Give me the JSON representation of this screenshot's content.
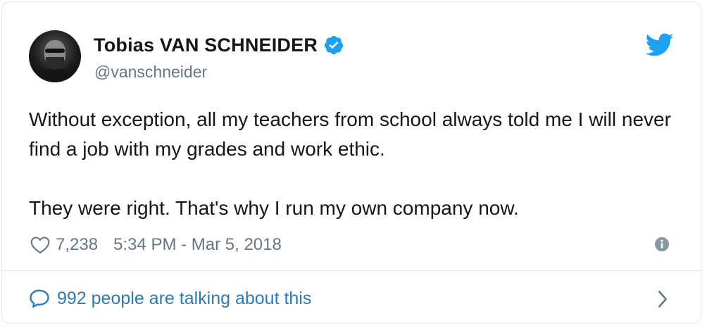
{
  "author": {
    "display_name": "Tobias VAN SCHNEIDER",
    "handle": "@vanschneider",
    "verified": true
  },
  "tweet": {
    "paragraphs": [
      "Without exception, all my teachers from school always told me I will never find a job with my grades and work ethic.",
      "They were right. That's why I run my own company now."
    ]
  },
  "meta": {
    "likes": "7,238",
    "timestamp": "5:34 PM - Mar 5, 2018"
  },
  "conversation": {
    "label": "992 people are talking about this"
  },
  "icons": {
    "verified": "verified-badge-icon",
    "brand": "twitter-bird-icon",
    "like": "heart-icon",
    "info": "info-icon",
    "reply": "speech-bubble-icon",
    "more": "chevron-right-icon"
  },
  "colors": {
    "brand_blue": "#1da1f2",
    "link_blue": "#2b7bb9",
    "text": "#14171a",
    "muted": "#657786",
    "border": "#e1e8ed"
  }
}
